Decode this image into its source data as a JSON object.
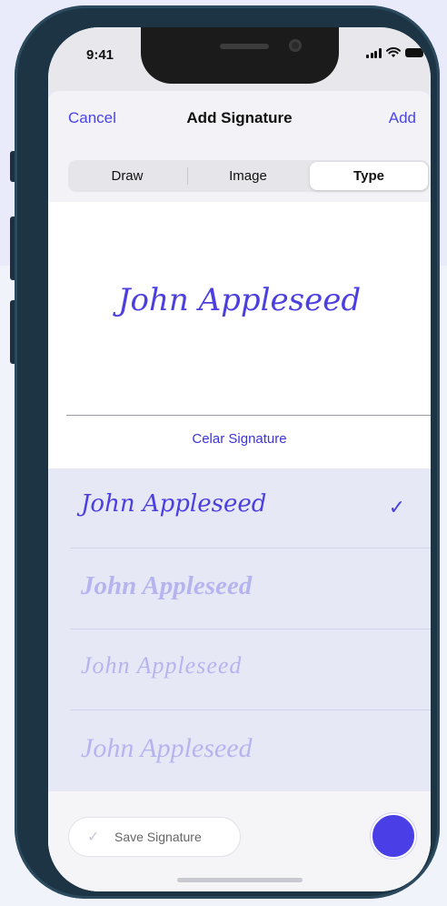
{
  "status_bar": {
    "time": "9:41"
  },
  "nav": {
    "cancel": "Cancel",
    "title": "Add Signature",
    "add": "Add"
  },
  "tabs": [
    {
      "label": "Draw",
      "active": false
    },
    {
      "label": "Image",
      "active": false
    },
    {
      "label": "Type",
      "active": true
    }
  ],
  "signature": {
    "text": "John Appleseed",
    "clear_label": "Celar Signature",
    "ink_color": "#4b3fe0"
  },
  "style_options": [
    {
      "text": "John Appleseed",
      "selected": true,
      "opacity": 1
    },
    {
      "text": "John Appleseed",
      "selected": false,
      "opacity": 0.3
    },
    {
      "text": "John Appleseed",
      "selected": false,
      "opacity": 0.3
    },
    {
      "text": "John Appleseed",
      "selected": false,
      "opacity": 0.3
    }
  ],
  "check_glyph": "✓",
  "bottom": {
    "save_label": "Save Signature",
    "selected_color": "#4a3fe6"
  }
}
